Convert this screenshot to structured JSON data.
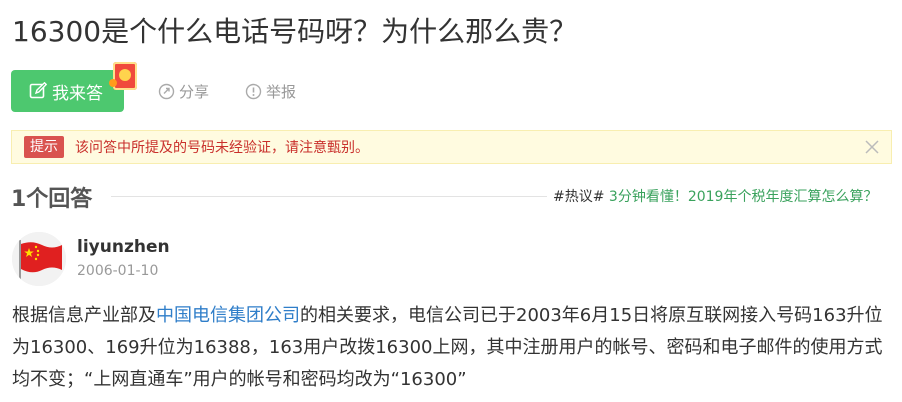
{
  "question": {
    "title": "16300是个什么电话号码呀？为什么那么贵？"
  },
  "toolbar": {
    "answer_label": "我来答",
    "share_label": "分享",
    "report_label": "举报"
  },
  "notice": {
    "tag": "提示",
    "message": "该问答中所提及的号码未经验证，请注意甄别。"
  },
  "answers": {
    "count_label": "1个回答",
    "hot_tag": "#热议#",
    "hot_link": "3分钟看懂！2019年个税年度汇算怎么算？"
  },
  "answer": {
    "username": "liyunzhen",
    "date": "2006-01-10",
    "content_before": "根据信息产业部及",
    "content_link": "中国电信集团公司",
    "content_after": "的相关要求，电信公司已于2003年6月15日将原互联网接入号码163升位为16300、169升位为16388，163用户改拨16300上网，其中注册用户的帐号、密码和电子邮件的使用方式均不变；“上网直通车”用户的帐号和密码均改为“16300”"
  },
  "colors": {
    "accent_green": "#4dc86f",
    "notice_red": "#c9302c",
    "link_blue": "#2f7ec9",
    "hot_green": "#3aa25d"
  }
}
